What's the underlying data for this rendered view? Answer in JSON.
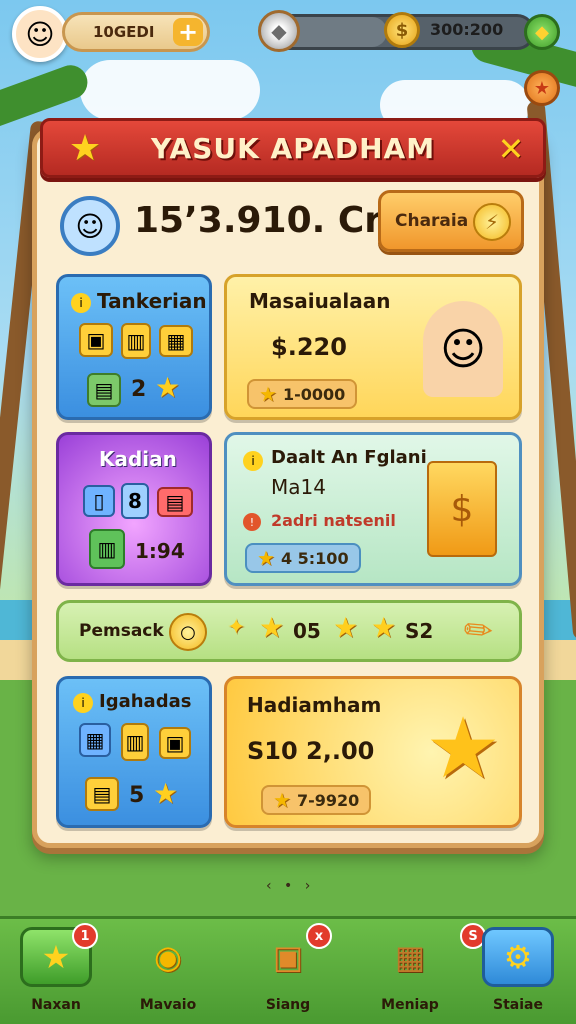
{
  "topbar": {
    "player_id": "10GEDI",
    "coins": "300:200",
    "energy_fraction": 0.45
  },
  "panel": {
    "title": "YASUK APADHAM",
    "score": "15’3.910. Crk",
    "score_button_label": "Charaia"
  },
  "cards": {
    "tankerian": {
      "title": "Tankerian",
      "count": "2"
    },
    "masaiualaan": {
      "title": "Masaiualaan",
      "price": "$.220",
      "stars": "1-0000"
    },
    "kadian": {
      "title": "Kadian",
      "value": "1:94"
    },
    "dealt": {
      "title": "Daalt An Fglani",
      "subtitle": "Ma14",
      "note": "2adri natsenil",
      "stars": "4 5:100"
    },
    "pemsack": {
      "label": "Pemsack",
      "value1": "05",
      "value2": "S2"
    },
    "igahadas": {
      "title": "Igahadas",
      "count": "5"
    },
    "hadiamham": {
      "title": "Hadiamham",
      "price": "S10 2,.00",
      "stars": "7-9920"
    }
  },
  "nav": {
    "items": [
      {
        "label": "Naxan",
        "badge": "1"
      },
      {
        "label": "Mavaio",
        "badge": ""
      },
      {
        "label": "Siang",
        "badge": "x"
      },
      {
        "label": "Meniap",
        "badge": "S"
      },
      {
        "label": "Staiae",
        "badge": ""
      }
    ]
  },
  "colors": {
    "ribbon": "#c7352b",
    "blue_card": "#4aa4ec",
    "purple_card": "#a64ee0",
    "yellow_card": "#ffe07a",
    "green_card": "#c6ecd6",
    "accent_gold": "#f5b700"
  },
  "icons": [
    "star-icon",
    "coin-icon",
    "gem-icon",
    "close-icon",
    "plus-icon",
    "settings-icon"
  ]
}
